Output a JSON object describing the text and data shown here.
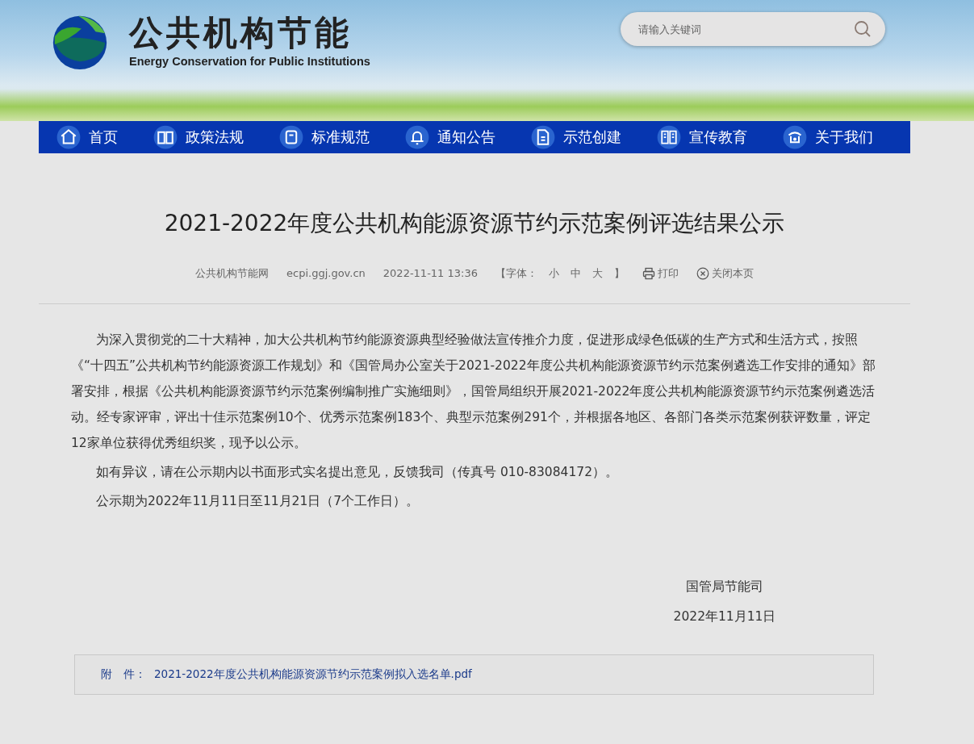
{
  "header": {
    "logo_title": "公共机构节能",
    "logo_subtitle": "Energy Conservation for Public Institutions",
    "search": {
      "placeholder": "请输入关键词"
    }
  },
  "nav": [
    {
      "label": "首页"
    },
    {
      "label": "政策法规"
    },
    {
      "label": "标准规范"
    },
    {
      "label": "通知公告"
    },
    {
      "label": "示范创建"
    },
    {
      "label": "宣传教育"
    },
    {
      "label": "关于我们"
    }
  ],
  "article": {
    "title": "2021-2022年度公共机构能源资源节约示范案例评选结果公示",
    "meta": {
      "source": "公共机构节能网",
      "site": "ecpi.ggj.gov.cn",
      "datetime": "2022-11-11 13:36",
      "font_label": "【字体：",
      "font_sizes": [
        "小",
        "中",
        "大"
      ],
      "font_close": "】",
      "print": "打印",
      "close": "关闭本页"
    },
    "paragraphs": [
      "为深入贯彻党的二十大精神，加大公共机构节约能源资源典型经验做法宣传推介力度，促进形成绿色低碳的生产方式和生活方式，按照《“十四五”公共机构节约能源资源工作规划》和《国管局办公室关于2021-2022年度公共机构能源资源节约示范案例遴选工作安排的通知》部署安排，根据《公共机构能源资源节约示范案例编制推广实施细则》，国管局组织开展2021-2022年度公共机构能源资源节约示范案例遴选活动。经专家评审，评出十佳示范案例10个、优秀示范案例183个、典型示范案例291个，并根据各地区、各部门各类示范案例获评数量，评定12家单位获得优秀组织奖，现予以公示。",
      "如有异议，请在公示期内以书面形式实名提出意见，反馈我司（传真号 010-83084172）。",
      "公示期为2022年11月11日至11月21日（7个工作日）。"
    ],
    "signature": "国管局节能司",
    "signature_date": "2022年11月11日",
    "attachment": {
      "label": "附　件：",
      "link": "2021-2022年度公共机构能源资源节约示范案例拟入选名单.pdf"
    }
  }
}
